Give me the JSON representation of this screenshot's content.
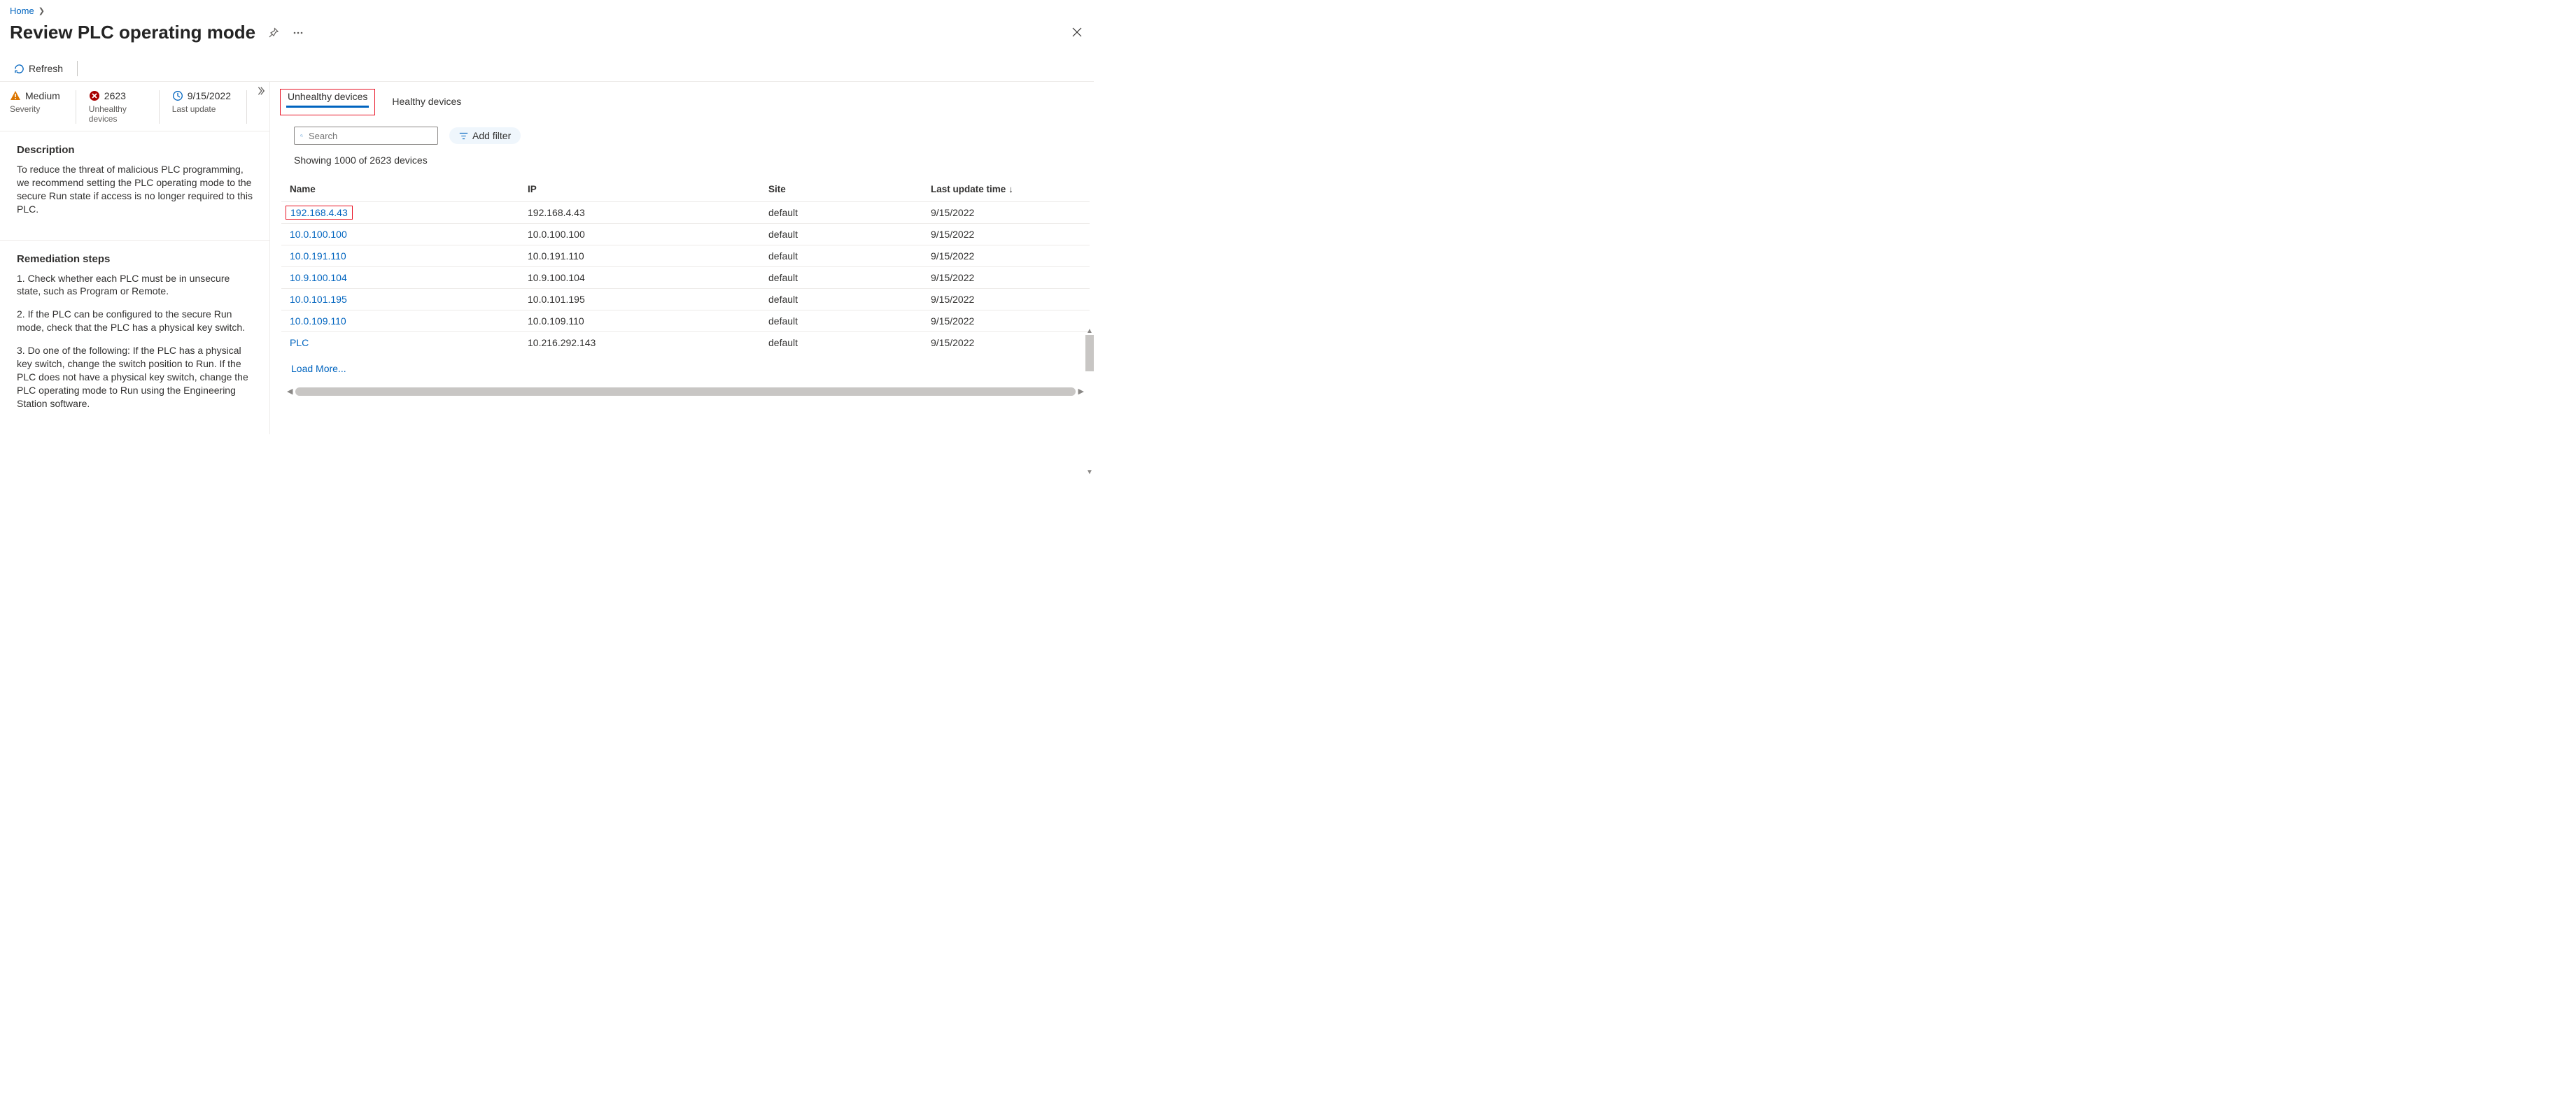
{
  "breadcrumb": {
    "home": "Home"
  },
  "title": "Review PLC operating mode",
  "toolbar": {
    "refresh": "Refresh"
  },
  "stats": {
    "severity_value": "Medium",
    "severity_label": "Severity",
    "unhealthy_value": "2623",
    "unhealthy_label": "Unhealthy devices",
    "update_value": "9/15/2022",
    "update_label": "Last update"
  },
  "description": {
    "heading": "Description",
    "body": "To reduce the threat of malicious PLC programming, we recommend setting the PLC operating mode to the secure Run state if access is no longer required to this PLC."
  },
  "remediation": {
    "heading": "Remediation steps",
    "step1": "1. Check whether each PLC must be in unsecure state, such as Program or Remote.",
    "step2": "2. If the PLC can be configured to the secure Run mode, check that the PLC has a physical key switch.",
    "step3": "3. Do one of the following: If the PLC has a physical key switch, change the switch position to Run. If the PLC does not have a physical key switch, change the PLC operating mode to Run using the Engineering Station software."
  },
  "tabs": {
    "unhealthy": "Unhealthy devices",
    "healthy": "Healthy devices"
  },
  "search": {
    "placeholder": "Search"
  },
  "filter": {
    "label": "Add filter"
  },
  "count_line": "Showing 1000 of 2623 devices",
  "columns": {
    "name": "Name",
    "ip": "IP",
    "site": "Site",
    "time": "Last update time"
  },
  "rows": [
    {
      "name": "192.168.4.43",
      "ip": "192.168.4.43",
      "site": "default",
      "time": "9/15/2022",
      "highlight": true
    },
    {
      "name": "10.0.100.100",
      "ip": "10.0.100.100",
      "site": "default",
      "time": "9/15/2022"
    },
    {
      "name": "10.0.191.110",
      "ip": "10.0.191.110",
      "site": "default",
      "time": "9/15/2022"
    },
    {
      "name": "10.9.100.104",
      "ip": "10.9.100.104",
      "site": "default",
      "time": "9/15/2022"
    },
    {
      "name": "10.0.101.195",
      "ip": "10.0.101.195",
      "site": "default",
      "time": "9/15/2022"
    },
    {
      "name": "10.0.109.110",
      "ip": "10.0.109.110",
      "site": "default",
      "time": "9/15/2022"
    },
    {
      "name": "PLC",
      "ip": "10.216.292.143",
      "site": "default",
      "time": "9/15/2022"
    }
  ],
  "load_more": "Load More..."
}
